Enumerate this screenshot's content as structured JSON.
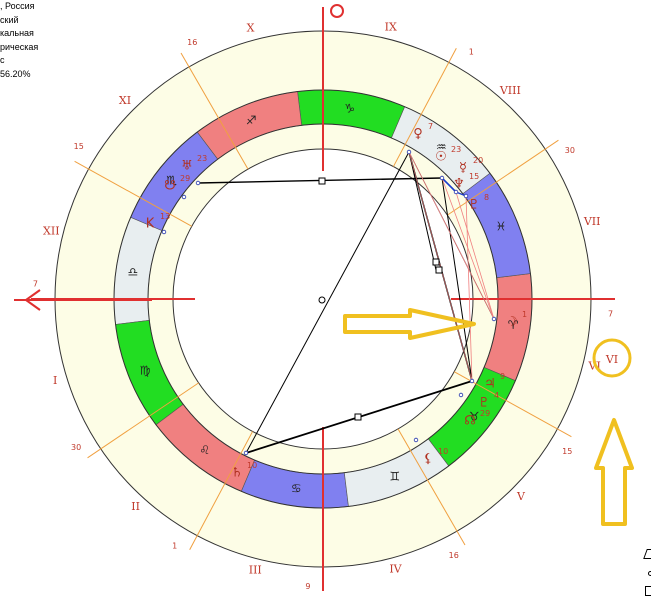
{
  "info": {
    "line1": ", Россия",
    "line2": "ский",
    "line3": "кальная",
    "line4": "рическая",
    "line5": "с",
    "line6": "56.20%"
  },
  "colors": {
    "ring_fill": "#fdfde6",
    "fire": "#f08080",
    "earth": "#22dd22",
    "air": "#e8eef0",
    "water": "#8080f0",
    "house_line": "#f0a040",
    "axis": "#e03030",
    "highlight": "#f0c020"
  },
  "houses": {
    "numerals": [
      "I",
      "II",
      "III",
      "IV",
      "V",
      "VI",
      "VII",
      "VIII",
      "IX",
      "X",
      "XI",
      "XII"
    ],
    "cusp_degrees": [
      "7",
      "30",
      "1",
      "9",
      "16",
      "15",
      "7",
      "30",
      "1",
      "",
      "16",
      "15"
    ]
  },
  "signs": [
    {
      "name": "aries",
      "glyph": "♈",
      "element": "fire"
    },
    {
      "name": "pisces",
      "glyph": "♓",
      "element": "water"
    },
    {
      "name": "aquarius",
      "glyph": "♒",
      "element": "air"
    },
    {
      "name": "capricorn",
      "glyph": "♑",
      "element": "earth"
    },
    {
      "name": "sagittarius",
      "glyph": "♐",
      "element": "fire"
    },
    {
      "name": "scorpio",
      "glyph": "♏",
      "element": "water"
    },
    {
      "name": "libra",
      "glyph": "♎",
      "element": "air"
    },
    {
      "name": "virgo",
      "glyph": "♍",
      "element": "earth"
    },
    {
      "name": "leo",
      "glyph": "♌",
      "element": "fire"
    },
    {
      "name": "cancer",
      "glyph": "♋",
      "element": "water"
    },
    {
      "name": "gemini",
      "glyph": "♊",
      "element": "air"
    },
    {
      "name": "taurus",
      "glyph": "♉",
      "element": "earth"
    }
  ],
  "planets": [
    {
      "name": "venus",
      "glyph": "♀",
      "degree": "7"
    },
    {
      "name": "sun",
      "glyph": "☉",
      "degree": "23"
    },
    {
      "name": "mercury",
      "glyph": "☿",
      "degree": "20"
    },
    {
      "name": "neptune",
      "glyph": "♆",
      "degree": "15"
    },
    {
      "name": "pluto",
      "glyph": "♇",
      "degree": "8"
    },
    {
      "name": "moon",
      "glyph": "☽",
      "degree": "1"
    },
    {
      "name": "jupiter",
      "glyph": "♃",
      "degree": "9"
    },
    {
      "name": "pluto2",
      "glyph": "♇",
      "degree": "4"
    },
    {
      "name": "north-node",
      "glyph": "☊",
      "degree": "29"
    },
    {
      "name": "lilith",
      "glyph": "⚸",
      "degree": "10"
    },
    {
      "name": "saturn",
      "glyph": "♄",
      "degree": "10"
    },
    {
      "name": "uranus",
      "glyph": "♅",
      "degree": "23"
    },
    {
      "name": "south-node",
      "glyph": "☋",
      "degree": "29"
    },
    {
      "name": "kora",
      "glyph": "K",
      "degree": "13"
    }
  ],
  "highlight_label": "VI"
}
